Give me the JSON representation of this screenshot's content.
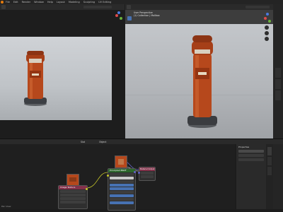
{
  "menubar": {
    "items": [
      "File",
      "Edit",
      "Render",
      "Window",
      "Help",
      "Layout",
      "Modeling",
      "Sculpting",
      "UV Editing"
    ]
  },
  "left_viewport": {
    "background": "#c9ccd0"
  },
  "right_viewport": {
    "header_text": "User Perspective",
    "sub_text": "(1) Collection | Mailbox",
    "background": "#b3b6ba",
    "object_color": "#b6481c"
  },
  "node_editor": {
    "header_labels": [
      "Slot",
      "Object"
    ],
    "bsdf_title": "Principled BSDF",
    "output_title": "Material Output",
    "image_node_title": "Image Texture",
    "footer_text": "Pan View"
  },
  "properties": {
    "tab_labels": [
      "Item",
      "Tool",
      "View"
    ],
    "panel_title": "Properties"
  },
  "colors": {
    "accent": "#4772b3",
    "socket_yellow": "#c7c729",
    "socket_grey": "#a1a1a1",
    "socket_purple": "#6363c7",
    "node_header_green": "#2b652b",
    "node_header_red": "#83314a"
  }
}
